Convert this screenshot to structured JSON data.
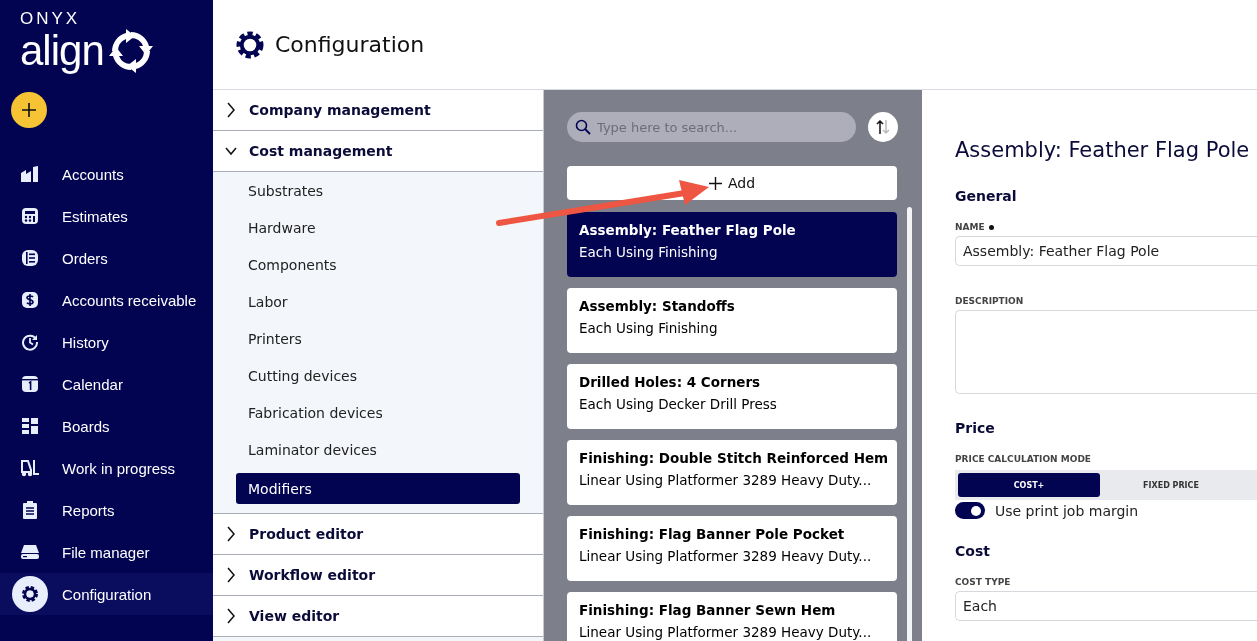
{
  "logo": {
    "brand": "ONYX",
    "product": "align"
  },
  "nav": [
    {
      "label": "Accounts",
      "selected": false
    },
    {
      "label": "Estimates",
      "selected": false
    },
    {
      "label": "Orders",
      "selected": false
    },
    {
      "label": "Accounts receivable",
      "selected": false
    },
    {
      "label": "History",
      "selected": false
    },
    {
      "label": "Calendar",
      "selected": false
    },
    {
      "label": "Boards",
      "selected": false
    },
    {
      "label": "Work in progress",
      "selected": false
    },
    {
      "label": "Reports",
      "selected": false
    },
    {
      "label": "File manager",
      "selected": false
    },
    {
      "label": "Configuration",
      "selected": true
    }
  ],
  "page_title": "Configuration",
  "tree": [
    {
      "label": "Company management",
      "expanded": false
    },
    {
      "label": "Cost management",
      "expanded": true,
      "children": [
        {
          "label": "Substrates",
          "selected": false
        },
        {
          "label": "Hardware",
          "selected": false
        },
        {
          "label": "Components",
          "selected": false
        },
        {
          "label": "Labor",
          "selected": false
        },
        {
          "label": "Printers",
          "selected": false
        },
        {
          "label": "Cutting devices",
          "selected": false
        },
        {
          "label": "Fabrication devices",
          "selected": false
        },
        {
          "label": "Laminator devices",
          "selected": false
        },
        {
          "label": "Modifiers",
          "selected": true
        }
      ]
    },
    {
      "label": "Product editor",
      "expanded": false
    },
    {
      "label": "Workflow editor",
      "expanded": false
    },
    {
      "label": "View editor",
      "expanded": false
    }
  ],
  "list": {
    "search_placeholder": "Type here to search...",
    "add_label": "Add",
    "items": [
      {
        "title": "Assembly: Feather Flag Pole",
        "subtitle": "Each Using Finishing",
        "selected": true
      },
      {
        "title": "Assembly: Standoffs",
        "subtitle": "Each Using Finishing",
        "selected": false
      },
      {
        "title": "Drilled Holes: 4 Corners",
        "subtitle": "Each Using Decker Drill Press",
        "selected": false
      },
      {
        "title": "Finishing: Double Stitch Reinforced Hem",
        "subtitle": "Linear Using Platformer 3289 Heavy Duty...",
        "selected": false
      },
      {
        "title": "Finishing: Flag Banner Pole Pocket",
        "subtitle": "Linear Using Platformer 3289 Heavy Duty...",
        "selected": false
      },
      {
        "title": "Finishing: Flag Banner Sewn Hem",
        "subtitle": "Linear Using Platformer 3289 Heavy Duty...",
        "selected": false
      }
    ]
  },
  "detail": {
    "title": "Assembly: Feather Flag Pole",
    "general": {
      "heading": "General",
      "name_label": "NAME",
      "name_required": true,
      "name_value": "Assembly: Feather Flag Pole",
      "description_label": "DESCRIPTION"
    },
    "price": {
      "heading": "Price",
      "mode_label": "PRICE CALCULATION MODE",
      "modes": [
        {
          "label": "COST+",
          "selected": true
        },
        {
          "label": "FIXED PRICE",
          "selected": false
        }
      ],
      "margin_toggle": {
        "label": "Use print job margin",
        "on": true
      }
    },
    "cost": {
      "heading": "Cost",
      "type_label": "COST TYPE",
      "type_value": "Each"
    }
  }
}
